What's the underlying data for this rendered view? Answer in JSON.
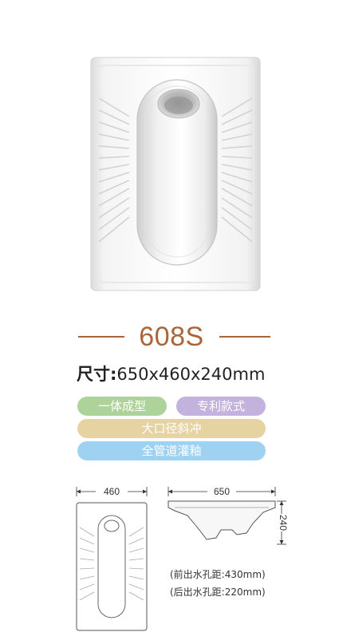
{
  "product": {
    "model": "608S",
    "size_label": "尺寸:",
    "size_value": "650x460x240mm"
  },
  "features": [
    {
      "label": "一体成型",
      "color": "#aed39a"
    },
    {
      "label": "专利款式",
      "color": "#c3b1de"
    },
    {
      "label": "大口径斜冲",
      "color": "#e6d3a2"
    },
    {
      "label": "全管道灌釉",
      "color": "#9fd1f0"
    }
  ],
  "drawings": {
    "top_view_width": "460",
    "side_view_length": "650",
    "side_view_height": "240",
    "front_outlet": "(前出水孔距:430mm)",
    "rear_outlet": "(后出水孔距:220mm)"
  }
}
